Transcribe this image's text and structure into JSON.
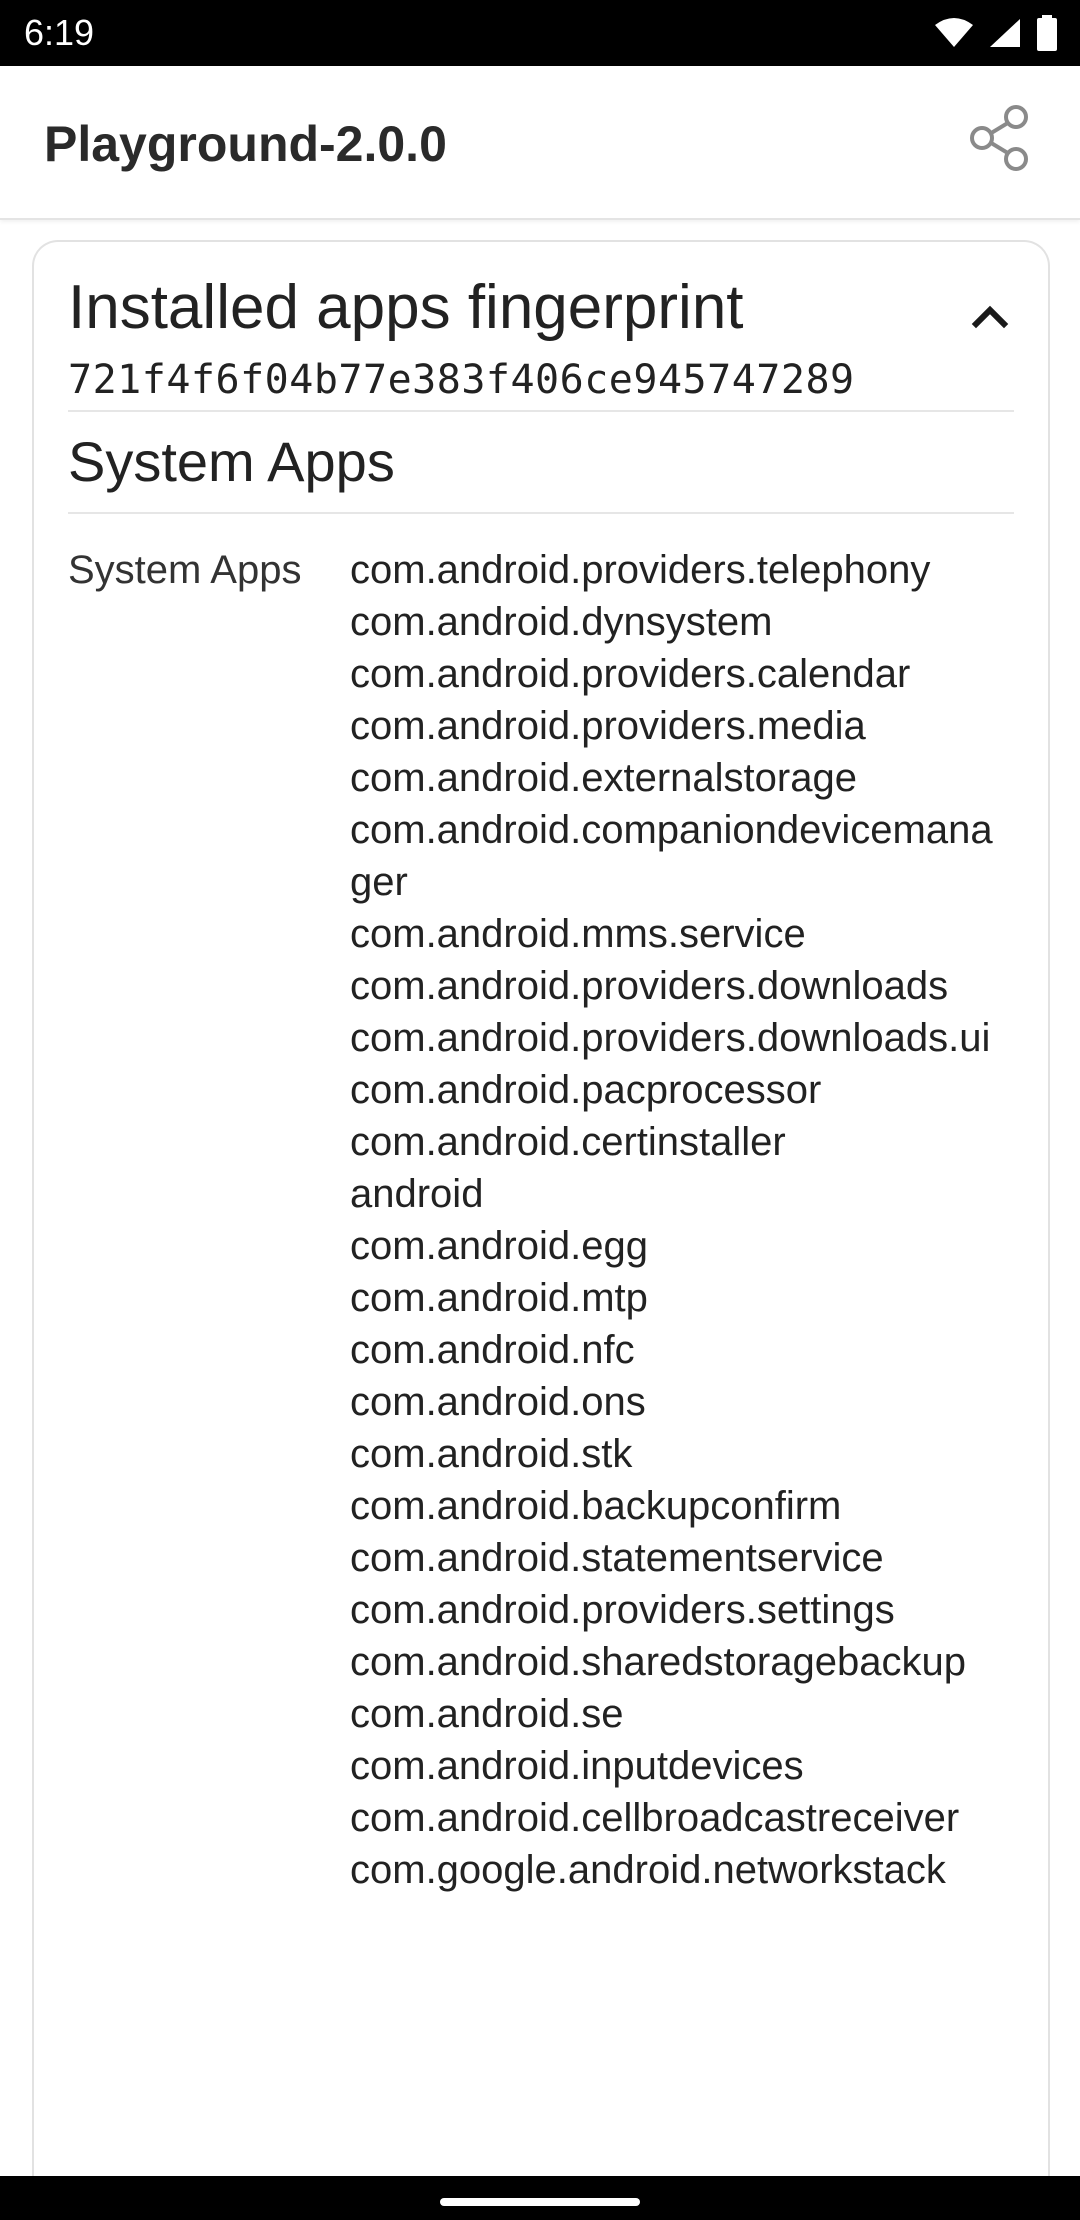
{
  "status_bar": {
    "time": "6:19",
    "icons": [
      "wifi-icon",
      "signal-icon",
      "battery-icon"
    ]
  },
  "app_bar": {
    "title": "Playground-2.0.0",
    "share_icon": "share-icon"
  },
  "card": {
    "title": "Installed apps fingerprint",
    "collapse_icon": "chevron-up-icon",
    "fingerprint": "721f4f6f04b77e383f406ce945747289",
    "section_title": "System Apps",
    "row_label": "System Apps",
    "apps": [
      "com.android.providers.telephony",
      "com.android.dynsystem",
      "com.android.providers.calendar",
      "com.android.providers.media",
      "com.android.externalstorage",
      "com.android.companiondevicemanager",
      "com.android.mms.service",
      "com.android.providers.downloads",
      "com.android.providers.downloads.ui",
      "com.android.pacprocessor",
      "com.android.certinstaller",
      "android",
      "com.android.egg",
      "com.android.mtp",
      "com.android.nfc",
      "com.android.ons",
      "com.android.stk",
      "com.android.backupconfirm",
      "com.android.statementservice",
      "com.android.providers.settings",
      "com.android.sharedstoragebackup",
      "com.android.se",
      "com.android.inputdevices",
      "com.android.cellbroadcastreceiver",
      "com.google.android.networkstack"
    ]
  },
  "colors": {
    "status_bar_bg": "#000000",
    "app_bar_bg": "#ffffff",
    "text": "#222222",
    "divider": "#e6e6e6"
  }
}
